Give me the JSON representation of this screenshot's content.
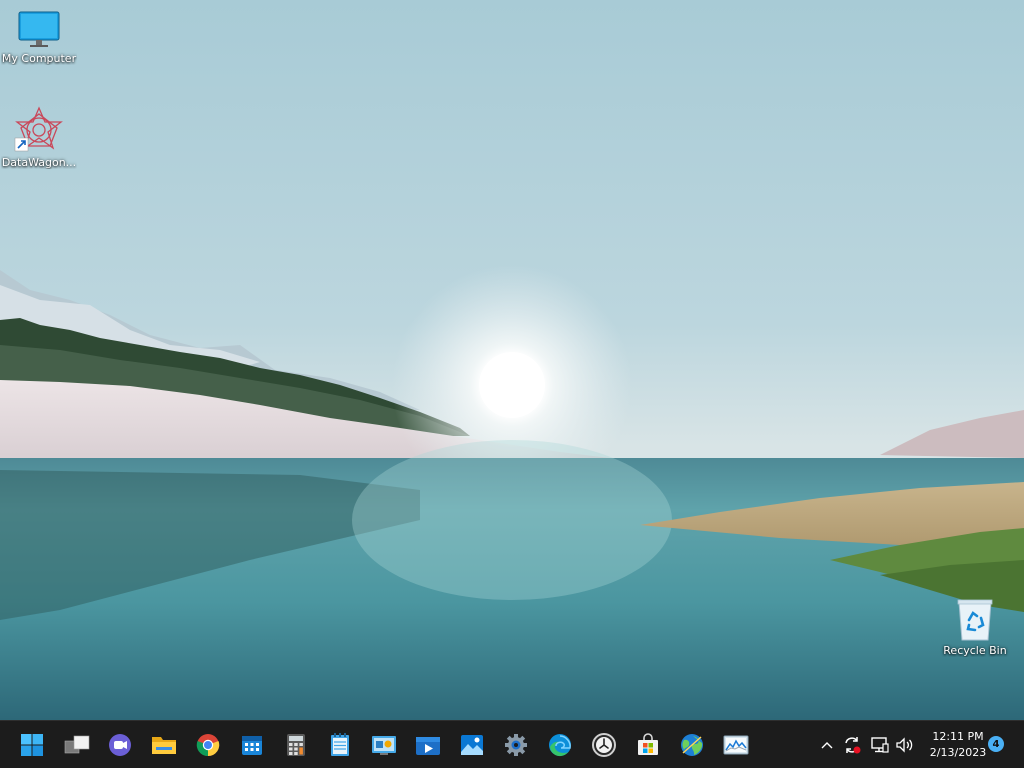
{
  "desktop": {
    "icons": [
      {
        "label": "My Computer",
        "icon": "monitor-icon"
      },
      {
        "label": "DataWagon...",
        "icon": "datawagon-shortcut-icon"
      },
      {
        "label": "Recycle Bin",
        "icon": "recycle-bin-icon"
      }
    ]
  },
  "taskbar": {
    "apps": [
      {
        "name": "Start",
        "icon": "windows-start-icon"
      },
      {
        "name": "Task View",
        "icon": "task-view-icon"
      },
      {
        "name": "Chat",
        "icon": "teams-chat-icon"
      },
      {
        "name": "File Explorer",
        "icon": "folder-icon"
      },
      {
        "name": "Google Chrome",
        "icon": "chrome-icon"
      },
      {
        "name": "Calendar",
        "icon": "calendar-icon"
      },
      {
        "name": "Calculator",
        "icon": "calculator-icon"
      },
      {
        "name": "Notepad",
        "icon": "notepad-icon"
      },
      {
        "name": "Control Panel",
        "icon": "control-panel-icon"
      },
      {
        "name": "Movies & TV",
        "icon": "movies-tv-icon"
      },
      {
        "name": "Photos",
        "icon": "photos-icon"
      },
      {
        "name": "Settings",
        "icon": "gear-icon"
      },
      {
        "name": "Microsoft Edge",
        "icon": "edge-icon"
      },
      {
        "name": "Clock",
        "icon": "clock-icon"
      },
      {
        "name": "Microsoft Store",
        "icon": "store-icon"
      },
      {
        "name": "Maps",
        "icon": "globe-icon"
      },
      {
        "name": "Resource Monitor",
        "icon": "performance-monitor-icon"
      }
    ],
    "tray": {
      "icons": [
        "chevron-up-icon",
        "sync-alert-icon",
        "network-icon",
        "volume-icon"
      ],
      "time": "12:11 PM",
      "date": "2/13/2023",
      "notification_count": "4"
    }
  },
  "colors": {
    "taskbar_bg": "#1c1c1c",
    "accent": "#4ab0f5"
  }
}
